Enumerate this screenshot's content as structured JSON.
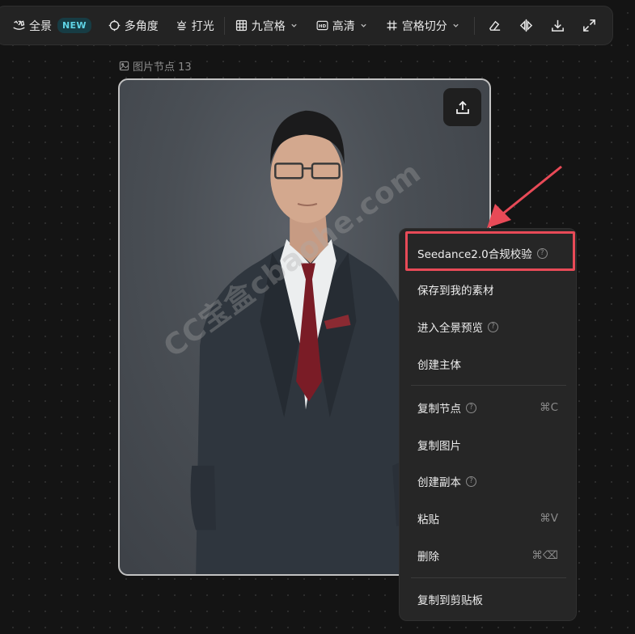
{
  "toolbar": {
    "panorama_label": "全景",
    "new_badge": "NEW",
    "multi_angle_label": "多角度",
    "lighting_label": "打光",
    "grid_label": "九宫格",
    "quality_label": "高清",
    "grid_cut_label": "宫格切分",
    "icons": [
      "panorama-icon",
      "multi-angle-icon",
      "lighting-icon",
      "grid-icon",
      "hd-icon",
      "hash-icon",
      "eraser-icon",
      "flip-icon",
      "download-icon",
      "expand-icon"
    ]
  },
  "node": {
    "label": "图片节点 13"
  },
  "watermark": "CC宝盒cbaohe.com",
  "menu": {
    "items": [
      {
        "label": "Seedance2.0合规校验",
        "help": "?",
        "shortcut": ""
      },
      {
        "label": "保存到我的素材",
        "help": "",
        "shortcut": ""
      },
      {
        "label": "进入全景预览",
        "help": "?",
        "shortcut": ""
      },
      {
        "label": "创建主体",
        "help": "",
        "shortcut": ""
      },
      {
        "label": "复制节点",
        "help": "?",
        "shortcut": "⌘C"
      },
      {
        "label": "复制图片",
        "help": "",
        "shortcut": ""
      },
      {
        "label": "创建副本",
        "help": "?",
        "shortcut": ""
      },
      {
        "label": "粘贴",
        "help": "",
        "shortcut": "⌘V"
      },
      {
        "label": "删除",
        "help": "",
        "shortcut": "⌘⌫"
      },
      {
        "label": "复制到剪贴板",
        "help": "",
        "shortcut": ""
      }
    ]
  },
  "colors": {
    "background": "#141414",
    "toolbar": "#232323",
    "menu": "#262626",
    "highlight": "#e84a57",
    "new_badge_text": "#5fd4e6"
  }
}
